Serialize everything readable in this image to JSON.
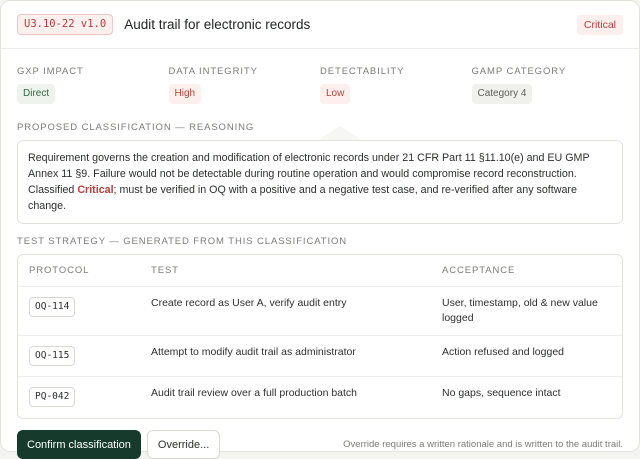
{
  "header": {
    "requirement_id": "U3.10-22 v1.0",
    "title": "Audit trail for electronic records",
    "severity": "Critical"
  },
  "metrics": [
    {
      "label": "GxP Impact",
      "value": "Direct",
      "tone": "green"
    },
    {
      "label": "Data Integrity",
      "value": "High",
      "tone": "red"
    },
    {
      "label": "Detectability",
      "value": "Low",
      "tone": "red"
    },
    {
      "label": "GAMP Category",
      "value": "Category 4",
      "tone": "gray"
    }
  ],
  "reasoning": {
    "label": "Proposed classification — reasoning",
    "text_before": "Requirement governs the creation and modification of electronic records under 21 CFR Part 11 §11.10(e) and EU GMP Annex 11 §9. Failure would not be detectable during routine operation and would compromise record reconstruction. Classified ",
    "emphasis": "Critical",
    "text_after": "; must be verified in OQ with a positive and a negative test case, and re-verified after any software change."
  },
  "strategy": {
    "label": "Test strategy — generated from this classification",
    "columns": [
      "Protocol",
      "Test",
      "Acceptance"
    ],
    "rows": [
      {
        "protocol": "OQ-114",
        "test": "Create record as User A, verify audit entry",
        "acceptance": "User, timestamp, old & new value logged"
      },
      {
        "protocol": "OQ-115",
        "test": "Attempt to modify audit trail as administrator",
        "acceptance": "Action refused and logged"
      },
      {
        "protocol": "PQ-042",
        "test": "Audit trail review over a full production batch",
        "acceptance": "No gaps, sequence intact"
      }
    ]
  },
  "footer": {
    "confirm_label": "Confirm classification",
    "override_label": "Override...",
    "note": "Override requires a written rationale and is written to the audit trail."
  },
  "colors": {
    "accent_red": "#b3403a",
    "primary_button": "#163b2c",
    "green": "#2f6b3f"
  }
}
